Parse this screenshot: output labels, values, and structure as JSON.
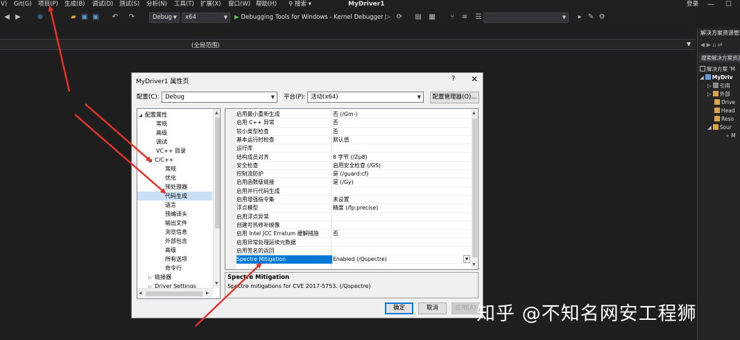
{
  "menubar": {
    "items": [
      "V)",
      "Git(G)",
      "项目(P)",
      "生成(B)",
      "调试(D)",
      "测试(S)",
      "分析(N)",
      "工具(T)",
      "扩展(X)",
      "窗口(W)",
      "帮助(H)"
    ],
    "search": "搜索",
    "window_title": "MyDriver1",
    "login": "登录",
    "win_min": "—",
    "win_max": "☐"
  },
  "toolbar": {
    "config": "Debug",
    "platform": "x64",
    "debugger": "Debugging Tools for Windows - Kernel Debugger"
  },
  "navbar": {
    "scope": "(全局范围)"
  },
  "solution_explorer": {
    "title": "解决方案资源管理器",
    "search_placeholder": "搜索解决方案资源管理器",
    "items": [
      {
        "label": "解决方案 'M",
        "caret": "",
        "bold": false
      },
      {
        "label": "MyDriv",
        "caret": "◢",
        "bold": true
      },
      {
        "label": "引用",
        "caret": "▷",
        "bold": false
      },
      {
        "label": "外部",
        "caret": "▷",
        "bold": false
      },
      {
        "label": "Drive",
        "caret": "",
        "bold": false
      },
      {
        "label": "Head",
        "caret": "",
        "bold": false
      },
      {
        "label": "Reso",
        "caret": "",
        "bold": false
      },
      {
        "label": "Sour",
        "caret": "◢",
        "bold": false
      },
      {
        "label": "M",
        "caret": "",
        "bold": false
      }
    ]
  },
  "dialog": {
    "title": "MyDriver1 属性页",
    "help": "?",
    "close": "✕",
    "config_label": "配置(C):",
    "config_value": "Debug",
    "platform_label": "平台(P):",
    "platform_value": "活动(x64)",
    "config_manager": "配置管理器(O)...",
    "tree": [
      {
        "label": "配置属性",
        "caret": "◢",
        "level": 0,
        "selected": false
      },
      {
        "label": "常规",
        "caret": "",
        "level": 1,
        "selected": false
      },
      {
        "label": "高级",
        "caret": "",
        "level": 1,
        "selected": false
      },
      {
        "label": "调试",
        "caret": "",
        "level": 1,
        "selected": false
      },
      {
        "label": "VC++ 目录",
        "caret": "",
        "level": 1,
        "selected": false
      },
      {
        "label": "C/C++",
        "caret": "◢",
        "level": 1,
        "selected": false
      },
      {
        "label": "常规",
        "caret": "",
        "level": 2,
        "selected": false
      },
      {
        "label": "优化",
        "caret": "",
        "level": 2,
        "selected": false
      },
      {
        "label": "预处理器",
        "caret": "",
        "level": 2,
        "selected": false
      },
      {
        "label": "代码生成",
        "caret": "",
        "level": 2,
        "selected": true
      },
      {
        "label": "语言",
        "caret": "",
        "level": 2,
        "selected": false
      },
      {
        "label": "预编译头",
        "caret": "",
        "level": 2,
        "selected": false
      },
      {
        "label": "输出文件",
        "caret": "",
        "level": 2,
        "selected": false
      },
      {
        "label": "浏览信息",
        "caret": "",
        "level": 2,
        "selected": false
      },
      {
        "label": "外部包含",
        "caret": "",
        "level": 2,
        "selected": false
      },
      {
        "label": "高级",
        "caret": "",
        "level": 2,
        "selected": false
      },
      {
        "label": "所有选项",
        "caret": "",
        "level": 2,
        "selected": false
      },
      {
        "label": "命令行",
        "caret": "",
        "level": 2,
        "selected": false
      },
      {
        "label": "链接器",
        "caret": "▷",
        "level": 1,
        "selected": false
      },
      {
        "label": "Driver Settings",
        "caret": "▷",
        "level": 1,
        "selected": false
      }
    ],
    "properties": [
      {
        "name": "启用最小重新生成",
        "value": "否 (/Gm-)"
      },
      {
        "name": "启用 C++ 异常",
        "value": "否"
      },
      {
        "name": "较小类型检查",
        "value": "否"
      },
      {
        "name": "基本运行时检查",
        "value": "默认值"
      },
      {
        "name": "运行库",
        "value": ""
      },
      {
        "name": "结构成员对齐",
        "value": "8 字节 (/Zp8)"
      },
      {
        "name": "安全检查",
        "value": "启用安全检查 (/GS)"
      },
      {
        "name": "控制流防护",
        "value": "是 (/guard:cf)"
      },
      {
        "name": "启用函数级链接",
        "value": "是 (/Gy)"
      },
      {
        "name": "启用并行代码生成",
        "value": ""
      },
      {
        "name": "启用增强指令集",
        "value": "未设置"
      },
      {
        "name": "浮点模型",
        "value": "精度 (/fp:precise)"
      },
      {
        "name": "启用浮点异常",
        "value": ""
      },
      {
        "name": "创建可热修补映像",
        "value": ""
      },
      {
        "name": "启用 Intel JCC Erratum 缓解措施",
        "value": "否"
      },
      {
        "name": "启用异常处理延续元数据",
        "value": ""
      },
      {
        "name": "启用签名的返回",
        "value": ""
      },
      {
        "name": "Spectre Mitigation",
        "value": "Enabled (/Qspectre)"
      }
    ],
    "selected_property": "Spectre Mitigation",
    "description_title": "Spectre Mitigation",
    "description_text": "Spectre mitigations for CVE 2017-5753.     (/Qspectre)",
    "ok": "确定",
    "cancel": "取消",
    "apply": "应用(A)"
  },
  "watermark": "知乎 @不知名网安工程狮",
  "colors": {
    "ide_bg": "#1e1e1e",
    "dialog_bg": "#f0f0f0",
    "selection_blue": "#0078d7",
    "tree_selection": "#cce0f5",
    "annotation_arrow": "#e5332a"
  },
  "icons": [
    "back-icon",
    "forward-icon",
    "new-item-icon",
    "open-icon",
    "save-icon",
    "save-all-icon",
    "undo-icon",
    "redo-icon",
    "play-icon",
    "refresh-icon"
  ]
}
